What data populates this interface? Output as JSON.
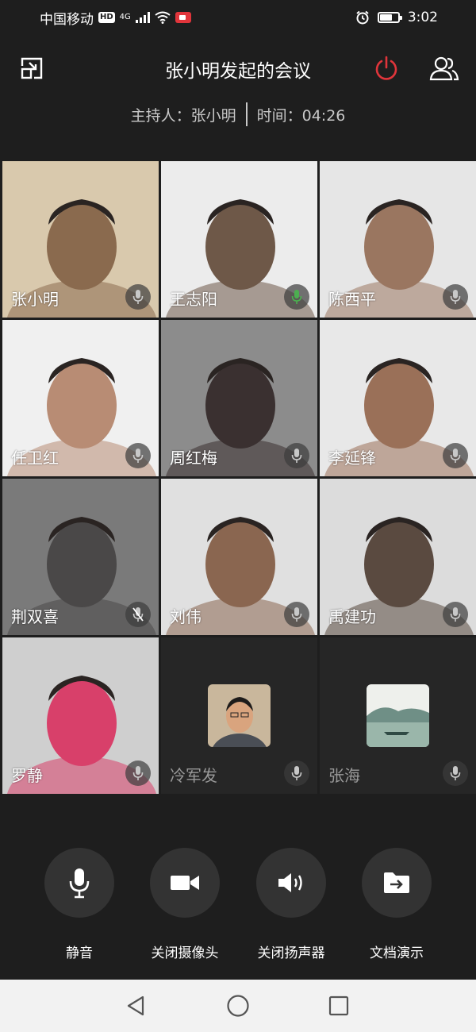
{
  "status_bar": {
    "carrier": "中国移动",
    "hd_badge": "HD",
    "network": "4G",
    "time": "3:02",
    "battery_level": 0.7,
    "icons": [
      "signal-icon",
      "wifi-icon",
      "screen-record-icon",
      "alarm-icon",
      "battery-icon"
    ]
  },
  "header": {
    "title": "张小明发起的会议",
    "host_label": "主持人：张小明",
    "time_label": "时间：04:26",
    "icons": [
      "minimize-window-icon",
      "end-meeting-power-icon",
      "participants-icon"
    ],
    "colors": {
      "end_meeting": "#e0353b"
    }
  },
  "participants": [
    {
      "name": "张小明",
      "video": true,
      "mic": "on",
      "tile_colors": [
        "#d9c9ad",
        "#8a6a4e"
      ]
    },
    {
      "name": "王志阳",
      "video": true,
      "mic": "active",
      "tile_colors": [
        "#ececec",
        "#6e5848"
      ]
    },
    {
      "name": "陈西平",
      "video": true,
      "mic": "on",
      "tile_colors": [
        "#e6e6e6",
        "#9a7660"
      ]
    },
    {
      "name": "任卫红",
      "video": true,
      "mic": "on",
      "tile_colors": [
        "#f0f0f0",
        "#b88c74"
      ]
    },
    {
      "name": "周红梅",
      "video": true,
      "mic": "on",
      "tile_colors": [
        "#8c8c8c",
        "#3a3030"
      ]
    },
    {
      "name": "李延锋",
      "video": true,
      "mic": "on",
      "tile_colors": [
        "#e8e8e8",
        "#9a7058"
      ]
    },
    {
      "name": "荆双喜",
      "video": true,
      "mic": "muted",
      "tile_colors": [
        "#7a7a7a",
        "#4a4848"
      ]
    },
    {
      "name": "刘伟",
      "video": true,
      "mic": "on",
      "tile_colors": [
        "#e0e0e0",
        "#8a6650"
      ]
    },
    {
      "name": "禹建功",
      "video": true,
      "mic": "on",
      "tile_colors": [
        "#dcdcdc",
        "#5a4a40"
      ]
    },
    {
      "name": "罗静",
      "video": true,
      "mic": "on",
      "tile_colors": [
        "#cfcfcf",
        "#d8406a"
      ]
    },
    {
      "name": "冷军发",
      "video": false,
      "mic": "on",
      "avatar": "person-photo-avatar"
    },
    {
      "name": "张海",
      "video": false,
      "mic": "on",
      "avatar": "landscape-avatar"
    }
  ],
  "toolbar": {
    "mute_label": "静音",
    "camera_label": "关闭摄像头",
    "speaker_label": "关闭扬声器",
    "share_label": "文档演示"
  },
  "nav": {
    "icons": [
      "back-triangle-icon",
      "home-circle-icon",
      "recents-square-icon"
    ]
  },
  "colors": {
    "background": "#1e1e1e",
    "active_mic": "#4caf50",
    "button_bg": "#333333",
    "navbar_bg": "#f2f2f2"
  }
}
